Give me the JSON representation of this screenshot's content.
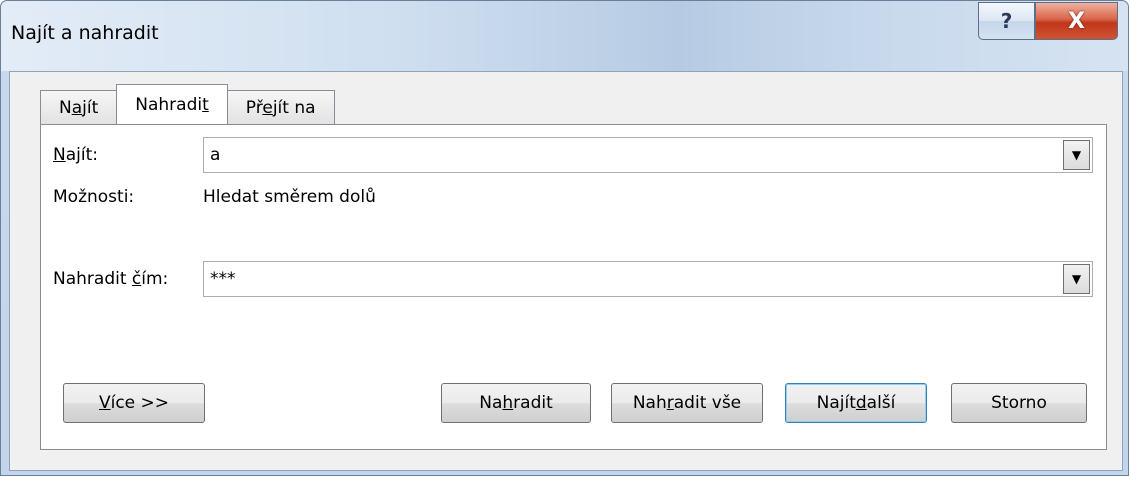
{
  "window": {
    "title": "Najít a nahradit",
    "help_glyph": "?",
    "close_glyph": "X"
  },
  "tabs": [
    {
      "pre": "N",
      "ul": "a",
      "post": "jít"
    },
    {
      "pre": "Nahradi",
      "ul": "t",
      "post": ""
    },
    {
      "pre": "Př",
      "ul": "e",
      "post": "jít na"
    }
  ],
  "find": {
    "label_ul": "N",
    "label_post": "ajít:",
    "value": "a"
  },
  "options": {
    "label": "Možnosti:",
    "value": "Hledat směrem dolů"
  },
  "replace": {
    "label_pre": "Nahradit ",
    "label_ul": "č",
    "label_post": "ím:",
    "value": "***"
  },
  "buttons": {
    "more_ul": "V",
    "more_post": "íce >>",
    "replace_pre": "Na",
    "replace_ul": "h",
    "replace_post": "radit",
    "replace_all_pre": "Nah",
    "replace_all_ul": "r",
    "replace_all_post": "adit vše",
    "find_next_pre": "Najít ",
    "find_next_ul": "d",
    "find_next_post": "alší",
    "cancel": "Storno"
  },
  "icons": {
    "dropdown": "chevron-down-icon",
    "help": "help-icon",
    "close": "close-icon"
  }
}
